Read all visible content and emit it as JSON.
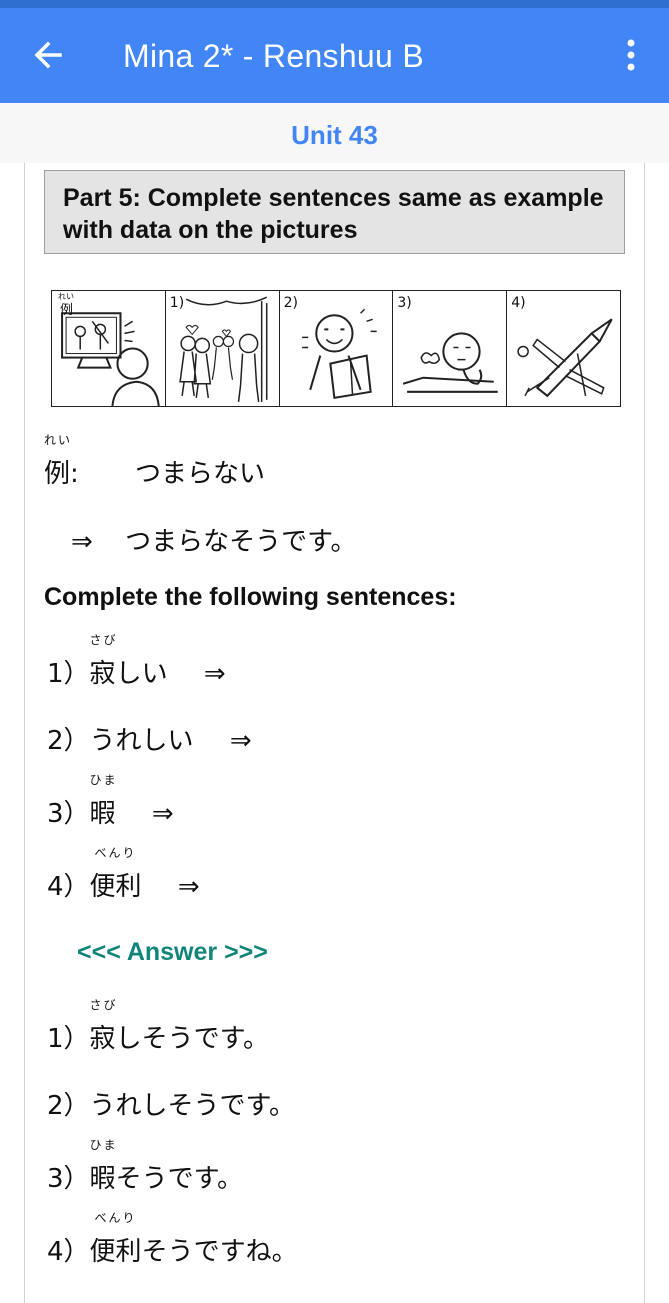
{
  "app_bar": {
    "title": "Mina 2* - Renshuu B"
  },
  "unit": {
    "title": "Unit 43"
  },
  "part": {
    "heading": "Part 5: Complete sentences same as example with data on the pictures"
  },
  "pictures": {
    "labels": [
      "例",
      "1)",
      "2)",
      "3)",
      "4)"
    ],
    "furigana_rei": "れい"
  },
  "example": {
    "label_kanji": "例",
    "label_furigana": "れい",
    "colon": ":",
    "prompt": "つまらない",
    "arrow": "⇒",
    "answer": "つまらなそうです。"
  },
  "instruction": "Complete the following sentences:",
  "questions": [
    {
      "num": "1）",
      "kanji": "寂",
      "furigana": "さび",
      "rest": "しい",
      "arrow": "⇒"
    },
    {
      "num": "2）",
      "kanji": "",
      "furigana": "",
      "rest": "うれしい",
      "arrow": "⇒"
    },
    {
      "num": "3）",
      "kanji": "暇",
      "furigana": "ひま",
      "rest": "",
      "arrow": "⇒"
    },
    {
      "num": "4）",
      "kanji": "便利",
      "furigana": "べんり",
      "rest": "",
      "arrow": "⇒"
    }
  ],
  "answer_toggle": "<<< Answer >>>",
  "answers": [
    {
      "num": "1）",
      "kanji": "寂",
      "furigana": "さび",
      "rest": "しそうです。"
    },
    {
      "num": "2）",
      "kanji": "",
      "furigana": "",
      "rest": "うれしそうです。"
    },
    {
      "num": "3）",
      "kanji": "暇",
      "furigana": "ひま",
      "rest": "そうです。"
    },
    {
      "num": "4）",
      "kanji": "便利",
      "furigana": "べんり",
      "rest": "そうですね。"
    }
  ],
  "colors": {
    "app_bar": "#4285f4",
    "unit_title": "#4285f4",
    "answer_link": "#10857a",
    "part_box_bg": "#e4e4e4"
  },
  "icons": {
    "back": "arrow-left-icon",
    "menu": "more-vertical-icon"
  }
}
